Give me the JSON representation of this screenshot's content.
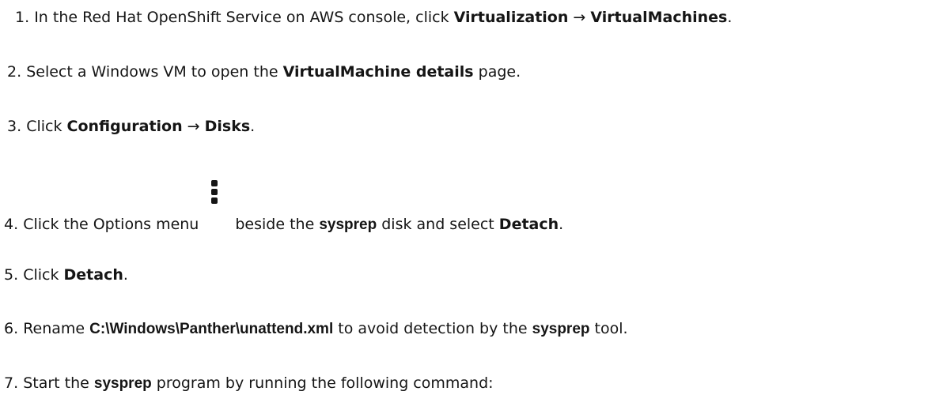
{
  "steps": [
    {
      "num": "1.",
      "t1": "In the Red Hat OpenShift Service on AWS console, click ",
      "u1": "Virtualization",
      "arrow": " → ",
      "u2": "VirtualMachines",
      "t2": "."
    },
    {
      "num": "2.",
      "t1": "Select a Windows VM to open the ",
      "u1": "VirtualMachine details",
      "t2": " page."
    },
    {
      "num": "3.",
      "t1": "Click ",
      "u1": "Configuration",
      "arrow": " → ",
      "u2": "Disks",
      "t2": "."
    },
    {
      "num": "4.",
      "t1": "Click the Options menu",
      "t2": "beside the ",
      "b1": "sysprep",
      "t3": " disk and select ",
      "u1": "Detach",
      "t4": "."
    },
    {
      "num": "5.",
      "t1": "Click ",
      "u1": "Detach",
      "t2": "."
    },
    {
      "num": "6.",
      "t1": "Rename ",
      "b1": "C:\\Windows\\Panther\\unattend.xml",
      "t2": " to avoid detection by the ",
      "b2": "sysprep",
      "t3": " tool."
    },
    {
      "num": "7.",
      "t1": "Start the ",
      "b1": "sysprep",
      "t2": " program by running the following command:"
    }
  ],
  "icons": {
    "options_menu": "kebab-menu-icon"
  }
}
